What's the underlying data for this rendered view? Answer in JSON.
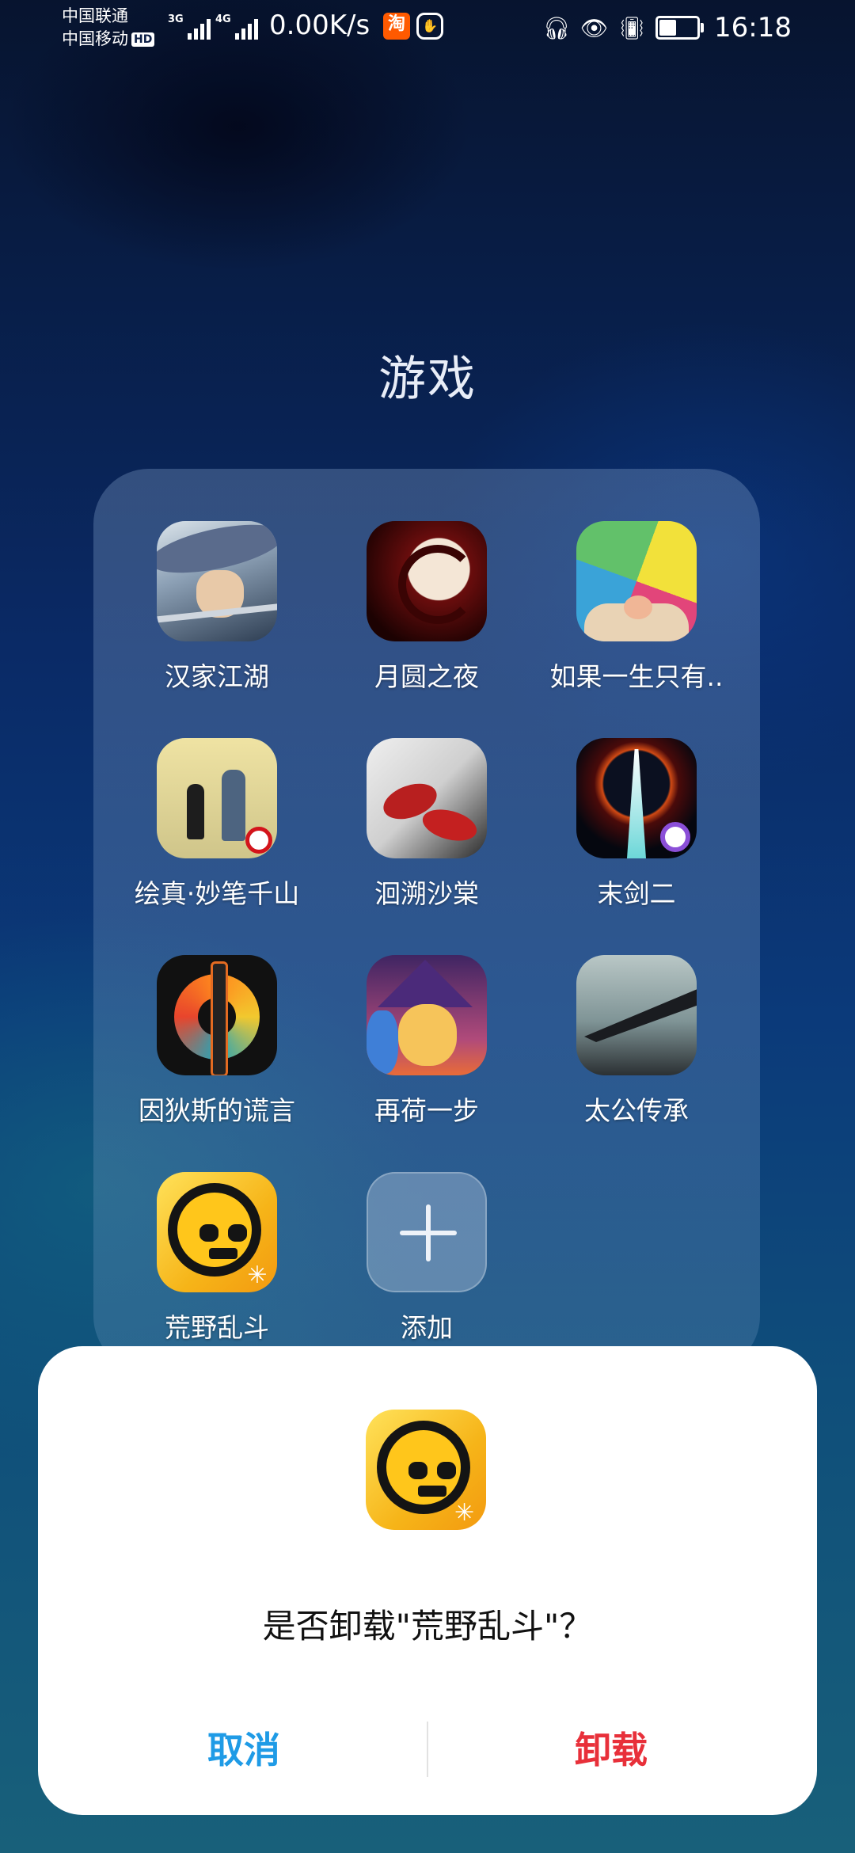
{
  "status_bar": {
    "carrier1": "中国联通",
    "carrier2": "中国移动",
    "hd_badge": "HD",
    "sig1_label": "3G",
    "sig2_label": "4G",
    "net_speed": "0.00K/s",
    "taobao_icon": "淘",
    "time": "16:18",
    "battery_level": 0.45
  },
  "folder": {
    "title": "游戏",
    "apps": [
      {
        "label": "汉家江湖",
        "icon": "hanjia-jianghu-icon"
      },
      {
        "label": "月圆之夜",
        "icon": "yueyuan-zhiye-icon"
      },
      {
        "label": "如果一生只有..",
        "icon": "ruguo-yisheng-icon"
      },
      {
        "label": "绘真·妙笔千山",
        "icon": "huizhen-miaobi-icon"
      },
      {
        "label": "洄溯沙棠",
        "icon": "huisu-shatang-icon"
      },
      {
        "label": "末剑二",
        "icon": "mojian-er-icon"
      },
      {
        "label": "因狄斯的谎言",
        "icon": "yindisi-icon"
      },
      {
        "label": "再荷一步",
        "icon": "zaihe-yibu-icon"
      },
      {
        "label": "太公传承",
        "icon": "taigong-chuancheng-icon"
      },
      {
        "label": "荒野乱斗",
        "icon": "brawl-stars-icon"
      }
    ],
    "add_label": "添加"
  },
  "dialog": {
    "message": "是否卸载\"荒野乱斗\"？",
    "cancel_label": "取消",
    "confirm_label": "卸载",
    "cancel_color": "#1f9be6",
    "confirm_color": "#e8303a"
  }
}
